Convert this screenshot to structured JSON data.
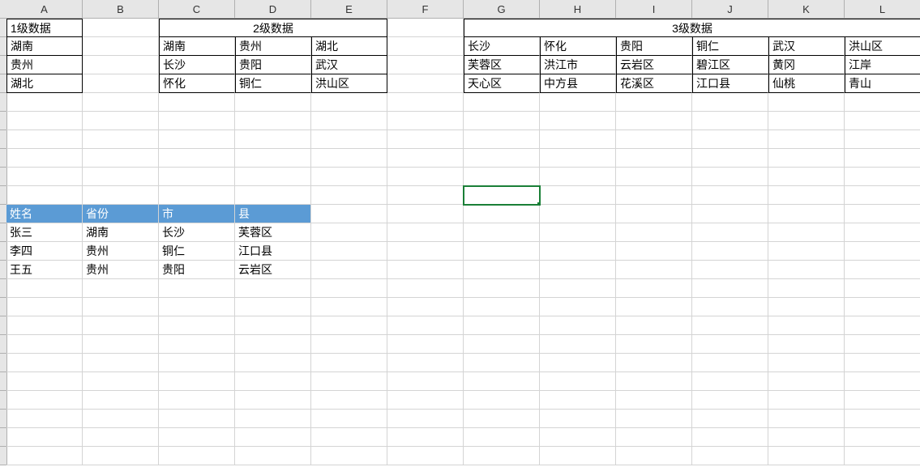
{
  "columns": [
    "A",
    "B",
    "C",
    "D",
    "E",
    "F",
    "G",
    "H",
    "I",
    "J",
    "K",
    "L"
  ],
  "rows": 24,
  "selected_cell": "G10",
  "level1": {
    "title": "1级数据",
    "values": [
      "湖南",
      "贵州",
      "湖北"
    ]
  },
  "level2": {
    "title": "2级数据",
    "cols": [
      "湖南",
      "贵州",
      "湖北"
    ],
    "rows": [
      [
        "长沙",
        "贵阳",
        "武汉"
      ],
      [
        "怀化",
        "铜仁",
        "洪山区"
      ]
    ]
  },
  "level3": {
    "title": "3级数据",
    "cols": [
      "长沙",
      "怀化",
      "贵阳",
      "铜仁",
      "武汉",
      "洪山区"
    ],
    "rows": [
      [
        "芙蓉区",
        "洪江市",
        "云岩区",
        "碧江区",
        "黄冈",
        "江岸"
      ],
      [
        "天心区",
        "中方县",
        "花溪区",
        "江口县",
        "仙桃",
        "青山"
      ]
    ]
  },
  "table": {
    "headers": [
      "姓名",
      "省份",
      "市",
      "县"
    ],
    "rows": [
      [
        "张三",
        "湖南",
        "长沙",
        "芙蓉区"
      ],
      [
        "李四",
        "贵州",
        "铜仁",
        "江口县"
      ],
      [
        "王五",
        "贵州",
        "贵阳",
        "云岩区"
      ]
    ]
  }
}
